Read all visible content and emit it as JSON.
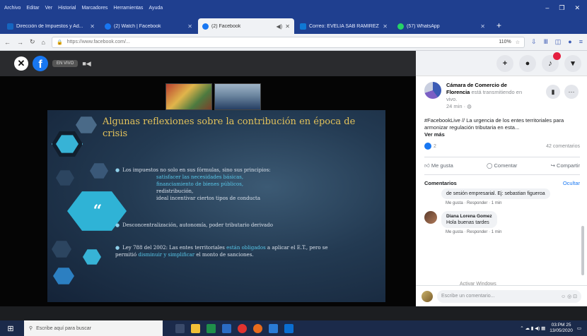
{
  "browser": {
    "menu": [
      "Archivo",
      "Editar",
      "Ver",
      "Historial",
      "Marcadores",
      "Herramientas",
      "Ayuda"
    ],
    "tabs": [
      {
        "label": "Dirección de Impuestos y Ad...",
        "color": "#1565c0",
        "active": false
      },
      {
        "label": "(2) Watch | Facebook",
        "color": "#1877f2",
        "active": false
      },
      {
        "label": "(2) Facebook",
        "color": "#1877f2",
        "active": true
      },
      {
        "label": "Correo: EVELIA SAB RAMIREZ",
        "color": "#0f78d4",
        "active": false
      },
      {
        "label": "(57) WhatsApp",
        "color": "#25d366",
        "active": false
      }
    ],
    "url": "https://www.facebook.com/...",
    "zoom": "110%"
  },
  "video": {
    "live_pill": "EN VIVO",
    "slide": {
      "title": "Algunas reflexiones sobre la contribución en época de crisis",
      "bullet1_intro": "Los impuestos no solo en sus fórmulas, sino sus principios:",
      "bullet1_sub1": "satisfacer las necesidades básicas,",
      "bullet1_sub2": "financiamiento de bienes públicos,",
      "bullet1_sub3": "redistribución,",
      "bullet1_sub4": "ideal incentivar ciertos tipos de conducta",
      "bullet2": "Desconcentralización, autonomía, poder tributario derivado",
      "bullet3_a": "Ley 788 del 2002: Las entes territoriales",
      "bullet3_hl1": "están obligados",
      "bullet3_b": "a aplicar el E.T., pero se permitió",
      "bullet3_hl2": "disminuir y simplificar",
      "bullet3_c": "el monto de sanciones."
    }
  },
  "post": {
    "page_name": "Cámara de Comercio de Florencia",
    "status": "está transmitiendo en vivo.",
    "time": "24 min",
    "text_hashtag": "#FacebookLive",
    "text": "// La urgencia de los entes territoriales para armonizar regulación tributaria en esta...",
    "see_more": "Ver más",
    "reactions": "2",
    "comments_count": "42 comentarios",
    "like_label": "Me gusta",
    "comment_label": "Comentar",
    "share_label": "Compartir"
  },
  "comments": {
    "header": "Comentarios",
    "order": "Ocultar",
    "items": [
      {
        "author": "",
        "text": "de sesión empresarial. Ej: sebastian figueroa",
        "like": "Me gusta",
        "reply": "Responder",
        "time": "1 min"
      },
      {
        "author": "Diana Lorena Gomez",
        "text": "Hola buenas tardes",
        "like": "Me gusta",
        "reply": "Responder",
        "time": "1 min"
      }
    ],
    "watermark": "Activar Windows",
    "composer_placeholder": "Escribe un comentario..."
  },
  "taskbar": {
    "search_placeholder": "Escribe aquí para buscar",
    "time": "03:PM 25",
    "date": "13/05/2020"
  }
}
